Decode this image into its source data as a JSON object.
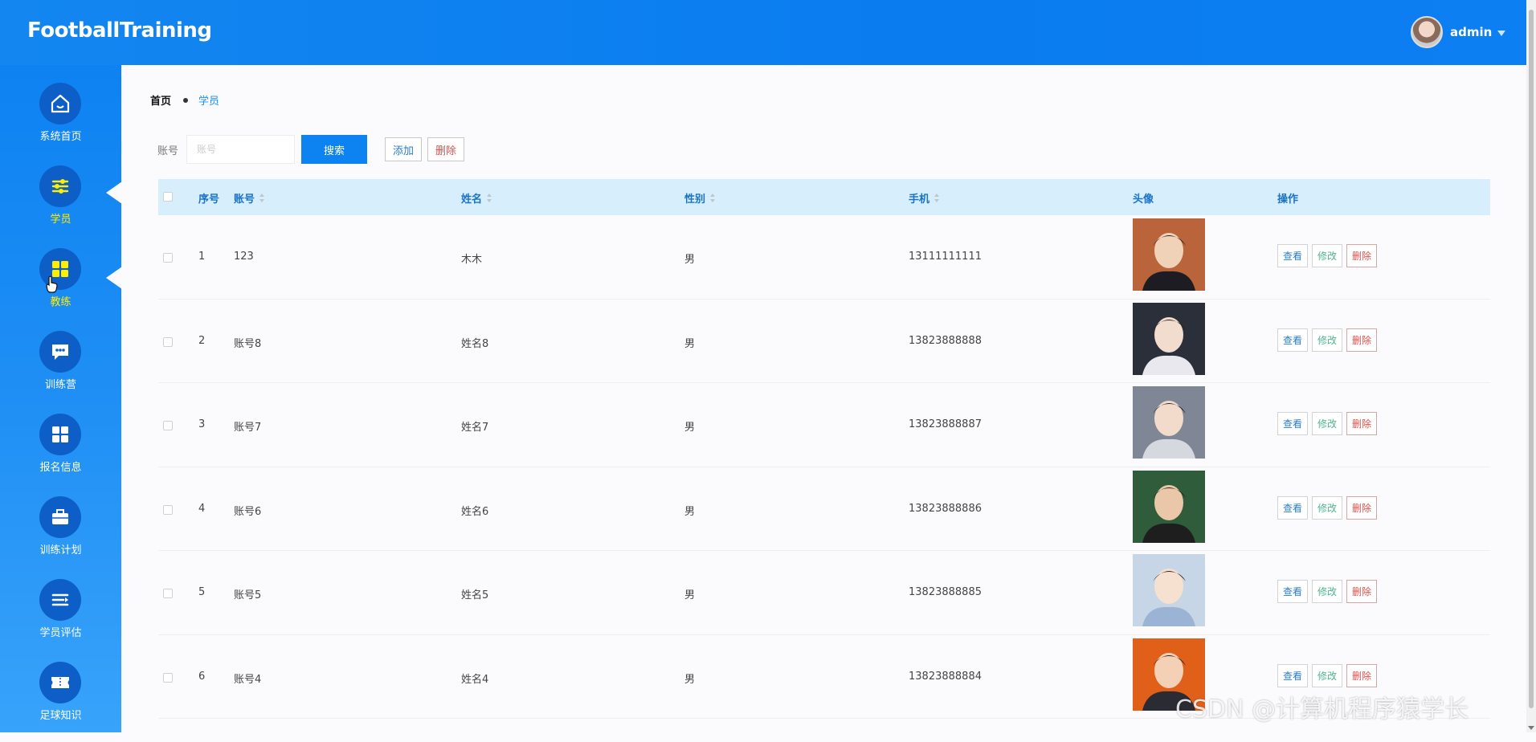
{
  "header": {
    "logo": "FootballTraining",
    "username": "admin"
  },
  "sidebar": {
    "items": [
      {
        "label": "系统首页",
        "icon": "home-icon"
      },
      {
        "label": "学员",
        "icon": "sliders-icon",
        "active": true
      },
      {
        "label": "教练",
        "icon": "grid-icon",
        "active": true
      },
      {
        "label": "训练营",
        "icon": "chat-icon"
      },
      {
        "label": "报名信息",
        "icon": "grid-icon"
      },
      {
        "label": "训练计划",
        "icon": "briefcase-icon"
      },
      {
        "label": "学员评估",
        "icon": "list-icon"
      },
      {
        "label": "足球知识",
        "icon": "ticket-icon"
      }
    ]
  },
  "breadcrumb": {
    "home": "首页",
    "current": "学员"
  },
  "search": {
    "label": "账号",
    "placeholder": "账号",
    "search_button": "搜索",
    "add_button": "添加",
    "delete_button": "删除"
  },
  "table": {
    "headers": {
      "index": "序号",
      "account": "账号",
      "name": "姓名",
      "gender": "性别",
      "phone": "手机",
      "avatar": "头像",
      "actions": "操作"
    },
    "rows": [
      {
        "index": "1",
        "account": "123",
        "name": "木木",
        "gender": "男",
        "phone": "13111111111"
      },
      {
        "index": "2",
        "account": "账号8",
        "name": "姓名8",
        "gender": "男",
        "phone": "13823888888"
      },
      {
        "index": "3",
        "account": "账号7",
        "name": "姓名7",
        "gender": "男",
        "phone": "13823888887"
      },
      {
        "index": "4",
        "account": "账号6",
        "name": "姓名6",
        "gender": "男",
        "phone": "13823888886"
      },
      {
        "index": "5",
        "account": "账号5",
        "name": "姓名5",
        "gender": "男",
        "phone": "13823888885"
      },
      {
        "index": "6",
        "account": "账号4",
        "name": "姓名4",
        "gender": "男",
        "phone": "13823888884"
      }
    ],
    "row_actions": {
      "view": "查看",
      "edit": "修改",
      "delete": "删除"
    }
  },
  "watermark": "CSDN @计算机程序猿学长"
}
